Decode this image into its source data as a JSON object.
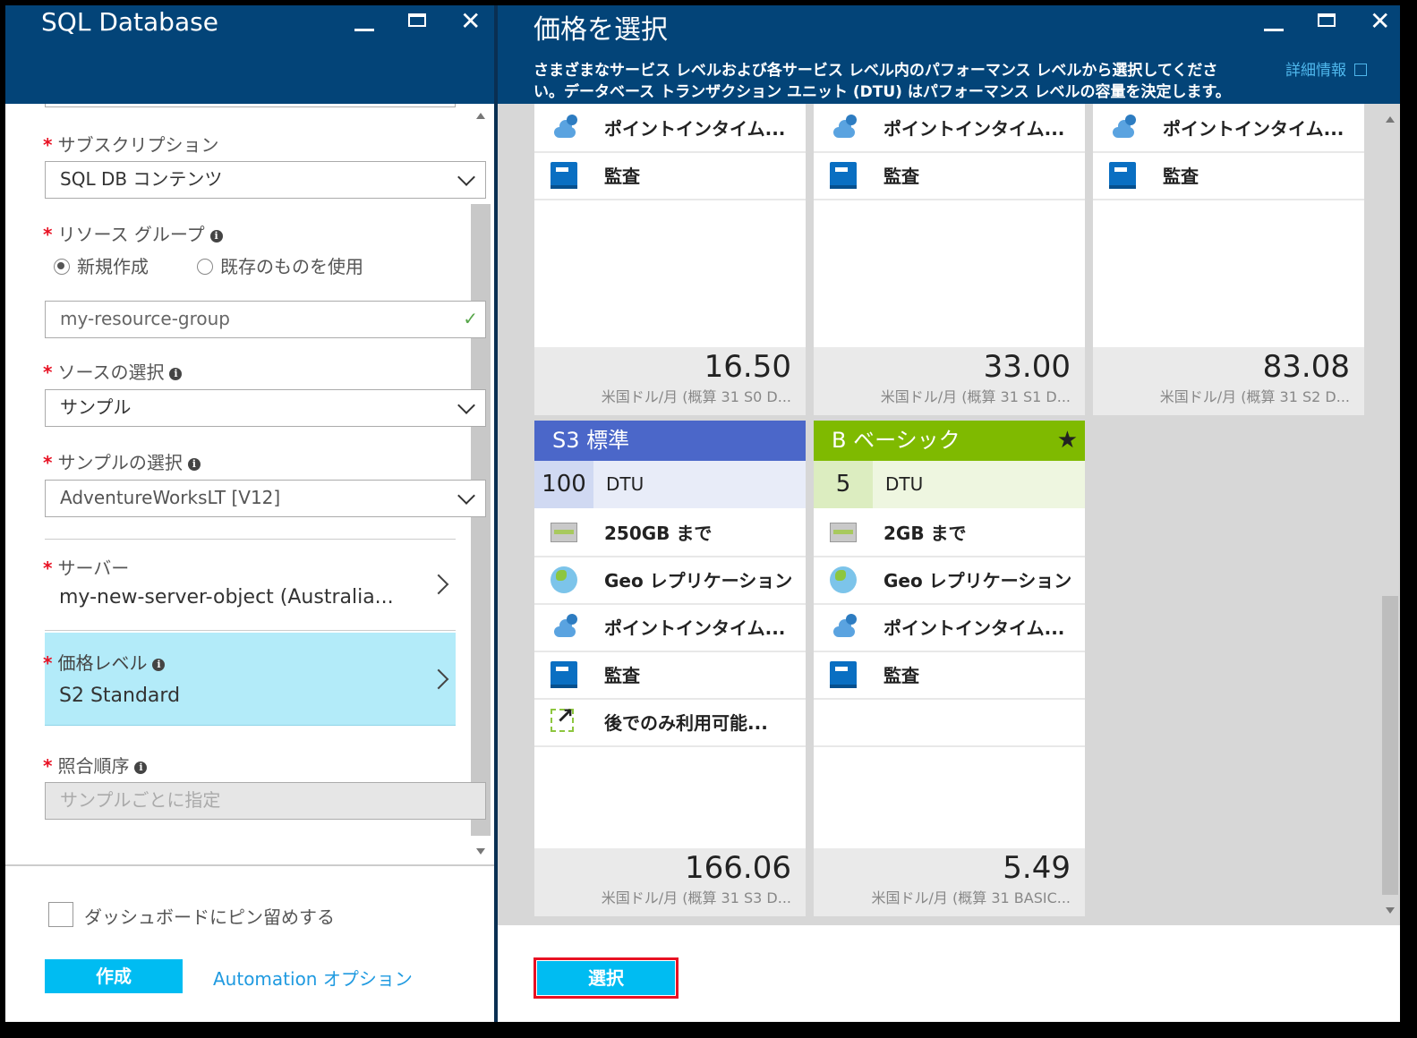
{
  "left_blade": {
    "title": "SQL Database",
    "subscription": {
      "label": "サブスクリプション",
      "value": "SQL DB コンテンツ"
    },
    "resource_group": {
      "label": "リソース グループ",
      "option_new": "新規作成",
      "option_existing": "既存のものを使用",
      "value": "my-resource-group"
    },
    "source": {
      "label": "ソースの選択",
      "value": "サンプル"
    },
    "sample": {
      "label": "サンプルの選択",
      "value": "AdventureWorksLT [V12]"
    },
    "server": {
      "label": "サーバー",
      "value": "my-new-server-object (Australia..."
    },
    "pricing": {
      "label": "価格レベル",
      "value": "S2 Standard"
    },
    "collation": {
      "label": "照合順序",
      "placeholder": "サンプルごとに指定"
    },
    "pin_label": "ダッシュボードにピン留めする",
    "create_label": "作成",
    "automation_label": "Automation オプション"
  },
  "right_blade": {
    "title": "価格を選択",
    "description_line1": "さまざまなサービス レベルおよび各サービス レベル内のパフォーマンス レベルから選択してくださ",
    "description_line2": "い。データベース トランザクション ユニット (DTU) はパフォーマンス レベルの容量を決定します。",
    "details_link": "詳細情報",
    "select_label": "選択",
    "top_cards": [
      {
        "feature1": "ポイントインタイム...",
        "feature2": "監査",
        "price": "16.50",
        "price_sub": "米国ドル/月 (概算 31 S0 D..."
      },
      {
        "feature1": "ポイントインタイム...",
        "feature2": "監査",
        "price": "33.00",
        "price_sub": "米国ドル/月 (概算 31 S1 D..."
      },
      {
        "feature1": "ポイントインタイム...",
        "feature2": "監査",
        "price": "83.08",
        "price_sub": "米国ドル/月 (概算 31 S2 D..."
      }
    ],
    "s3_card": {
      "tier": "S3 標準",
      "dtu_value": "100",
      "dtu_label": "DTU",
      "storage": "250GB まで",
      "geo": "Geo レプリケーション",
      "pitr": "ポイントインタイム...",
      "audit": "監査",
      "later": "後でのみ利用可能...",
      "price": "166.06",
      "price_sub": "米国ドル/月 (概算 31 S3 D...",
      "header_color": "#4b67c9"
    },
    "basic_card": {
      "tier": "B ベーシック",
      "dtu_value": "5",
      "dtu_label": "DTU",
      "storage": "2GB まで",
      "geo": "Geo レプリケーション",
      "pitr": "ポイントインタイム...",
      "audit": "監査",
      "price": "5.49",
      "price_sub": "米国ドル/月 (概算 31 BASIC...",
      "header_color": "#7fba00"
    }
  },
  "colors": {
    "header_bg": "#034478",
    "accent": "#00bcf2",
    "selected_row": "#b3ebf9",
    "link": "#1f9ae0",
    "highlight_border": "#e81123"
  }
}
